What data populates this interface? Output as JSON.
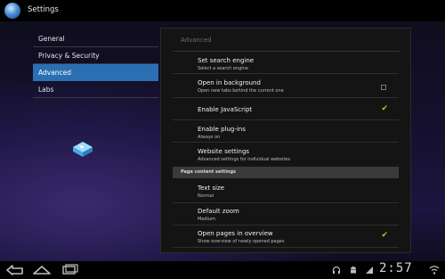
{
  "app": {
    "title": "Settings"
  },
  "nav": {
    "items": [
      {
        "label": "General",
        "active": false
      },
      {
        "label": "Privacy & Security",
        "active": false
      },
      {
        "label": "Advanced",
        "active": true
      },
      {
        "label": "Labs",
        "active": false
      }
    ]
  },
  "panel": {
    "title": "Advanced",
    "rows": {
      "search_engine": {
        "title": "Set search engine",
        "subtitle": "Select a search engine"
      },
      "open_background": {
        "title": "Open in background",
        "subtitle": "Open new tabs behind the current one",
        "checked": false
      },
      "enable_js": {
        "title": "Enable JavaScript",
        "checked": true
      },
      "plugins": {
        "title": "Enable plug-ins",
        "subtitle": "Always on"
      },
      "website_settings": {
        "title": "Website settings",
        "subtitle": "Advanced settings for individual websites"
      },
      "section_header": "Page content settings",
      "text_size": {
        "title": "Text size",
        "subtitle": "Normal"
      },
      "default_zoom": {
        "title": "Default zoom",
        "subtitle": "Medium"
      },
      "overview": {
        "title": "Open pages in overview",
        "subtitle": "Show overview of newly opened pages",
        "checked": true
      }
    }
  },
  "statusbar": {
    "time": "2:57",
    "icons": [
      "back-icon",
      "home-icon",
      "recent-apps-icon",
      "headphones-icon",
      "android-icon",
      "signal-icon"
    ]
  },
  "colors": {
    "accent": "#2b6fb3",
    "check": "#a3d12e"
  }
}
